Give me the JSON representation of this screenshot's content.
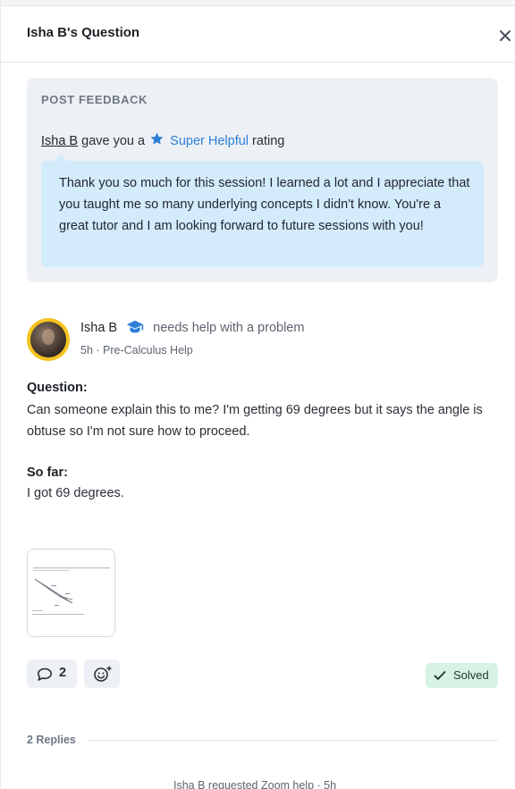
{
  "header": {
    "title": "Isha B's Question",
    "close_icon": "close-icon"
  },
  "feedback": {
    "heading": "POST FEEDBACK",
    "user": "Isha B",
    "gave_text": "gave you a",
    "rating": "Super Helpful",
    "rating_suffix": "rating",
    "star_icon": "star-icon",
    "star_color": "#2d7fd8",
    "message": "Thank you so much for this session! I learned a lot and I appreciate that you taught me so many underlying concepts I didn't know. You're a great tutor and I am looking forward to future sessions with you!"
  },
  "post": {
    "author": "Isha B",
    "author_icon": "graduation-cap-icon",
    "action": "needs help with a problem",
    "meta": "5h · Pre-Calculus Help",
    "question_label": "Question:",
    "question_text": "Can someone explain this to me? I'm getting 69 degrees but it says the angle is obtuse so I'm not sure how to proceed.",
    "so_far_label": "So far:",
    "so_far_text": "I got 69 degrees."
  },
  "actions": {
    "comment_icon": "comment-icon",
    "comment_count": "2",
    "react_icon": "add-reaction-icon",
    "solved_label": "Solved",
    "solved_icon": "check-icon",
    "solved_color": "#d7f3e4"
  },
  "replies": {
    "label": "2 Replies",
    "activity": "Isha B requested Zoom help · 5h"
  }
}
